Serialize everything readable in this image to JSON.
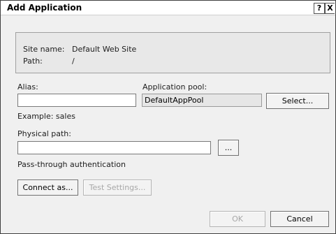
{
  "window": {
    "title": "Add Application",
    "help_glyph": "?",
    "close_glyph": "X"
  },
  "site": {
    "name_label": "Site name:",
    "name_value": "Default Web Site",
    "path_label": "Path:",
    "path_value": "/"
  },
  "form": {
    "alias_label": "Alias:",
    "alias_value": "",
    "alias_example": "Example: sales",
    "pool_label": "Application pool:",
    "pool_value": "DefaultAppPool",
    "select_button": "Select...",
    "physical_path_label": "Physical path:",
    "physical_path_value": "",
    "browse_button": "...",
    "passthrough_label": "Pass-through authentication",
    "connect_as_button": "Connect as...",
    "test_settings_button": "Test Settings..."
  },
  "footer": {
    "ok_button": "OK",
    "cancel_button": "Cancel"
  },
  "colors": {
    "window_bg": "#f0f0f0",
    "titlebar_bg": "#ffffff",
    "disabled_text": "#a8a8a8"
  }
}
